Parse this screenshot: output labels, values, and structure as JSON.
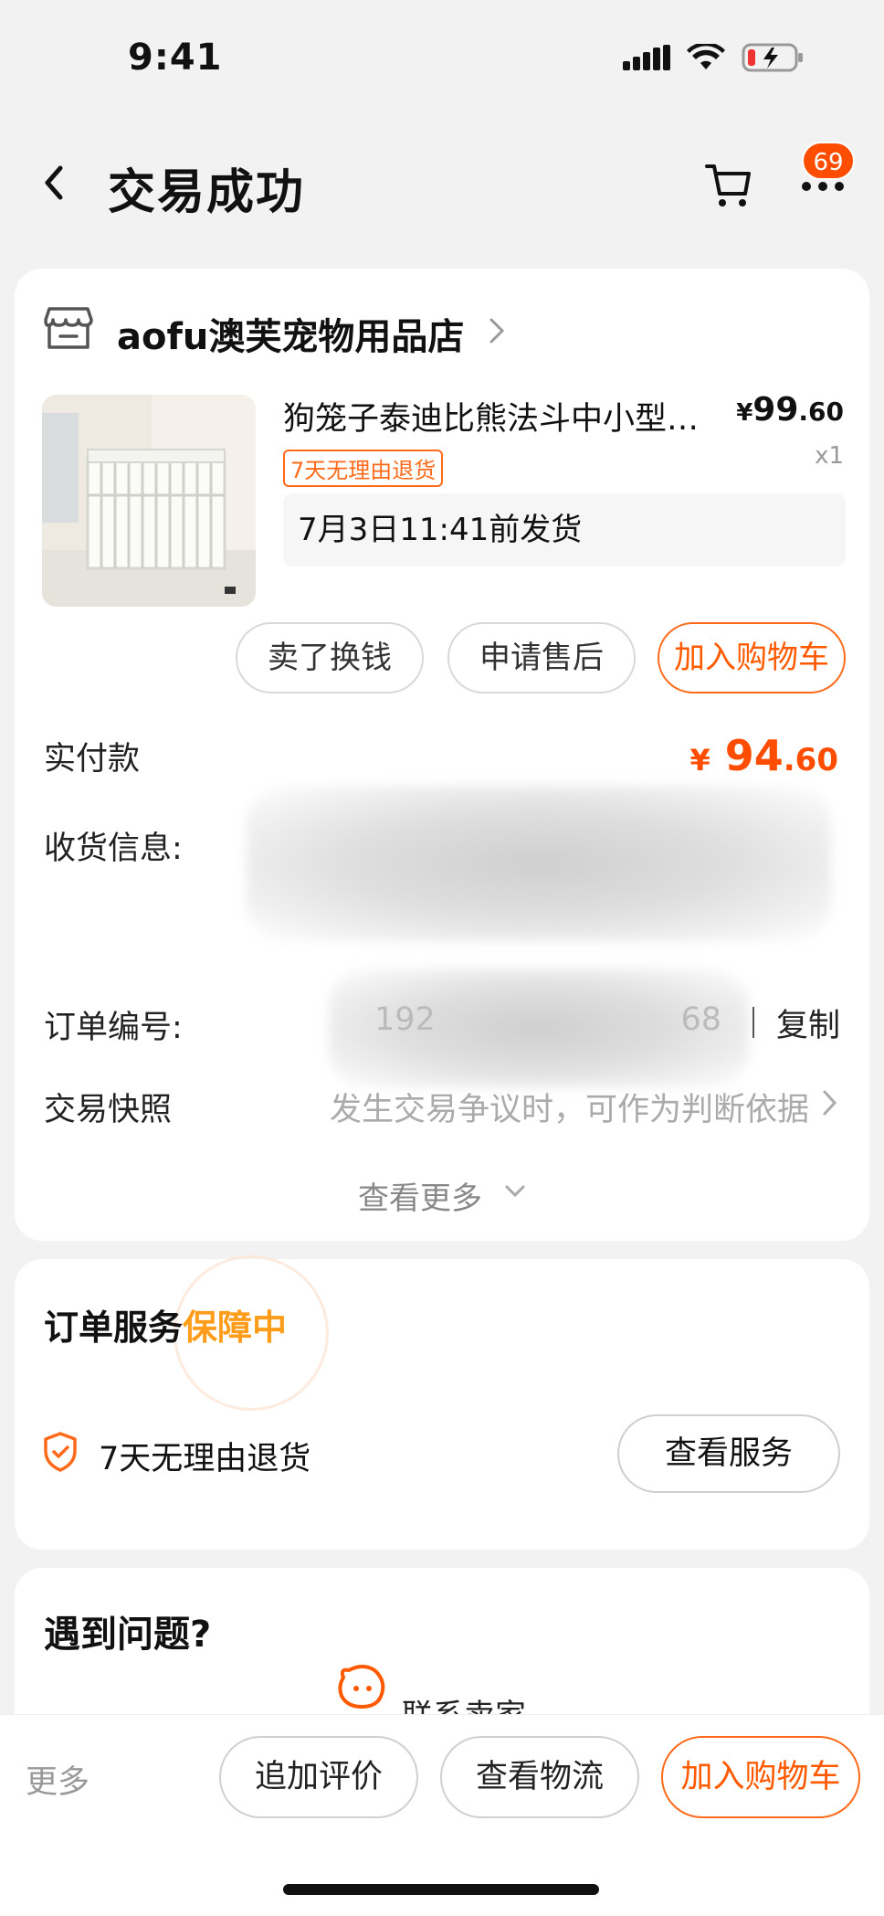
{
  "status": {
    "time": "9:41"
  },
  "nav": {
    "title": "交易成功",
    "badge": "69",
    "icons": [
      "back-icon",
      "cart-icon",
      "more-dots-icon"
    ]
  },
  "shop": {
    "name": "aofu澳芙宠物用品店"
  },
  "product": {
    "title": "狗笼子泰迪比熊法斗中小型宠物笼",
    "price_currency": "¥",
    "price_int": "99",
    "price_dec": ".60",
    "qty": "x1",
    "tag": "7天无理由退货",
    "ship": "7月3日11:41前发货"
  },
  "actions": {
    "sell": "卖了换钱",
    "after_sale": "申请售后",
    "add_cart": "加入购物车"
  },
  "info": {
    "paid_label": "实付款",
    "paid_currency": "¥",
    "paid_int": "94",
    "paid_dec": ".60",
    "address_label": "收货信息:",
    "order_label": "订单编号:",
    "order_value": "192",
    "order_value_tail": "68",
    "copy": "复制",
    "snapshot_label": "交易快照",
    "snapshot_hint": "发生交易争议时，可作为判断依据",
    "more": "查看更多"
  },
  "service": {
    "title": "订单服务",
    "title_status": "保障中",
    "item": "7天无理由退货",
    "button": "查看服务"
  },
  "problem": {
    "title": "遇到问题?",
    "contact": "联系卖家"
  },
  "bottom": {
    "more": "更多",
    "review": "追加评价",
    "logistics": "查看物流",
    "add_cart": "加入购物车"
  },
  "colors": {
    "accent": "#ff5a00",
    "badge": "#ff4d00",
    "highlight": "#ff9d1a"
  }
}
